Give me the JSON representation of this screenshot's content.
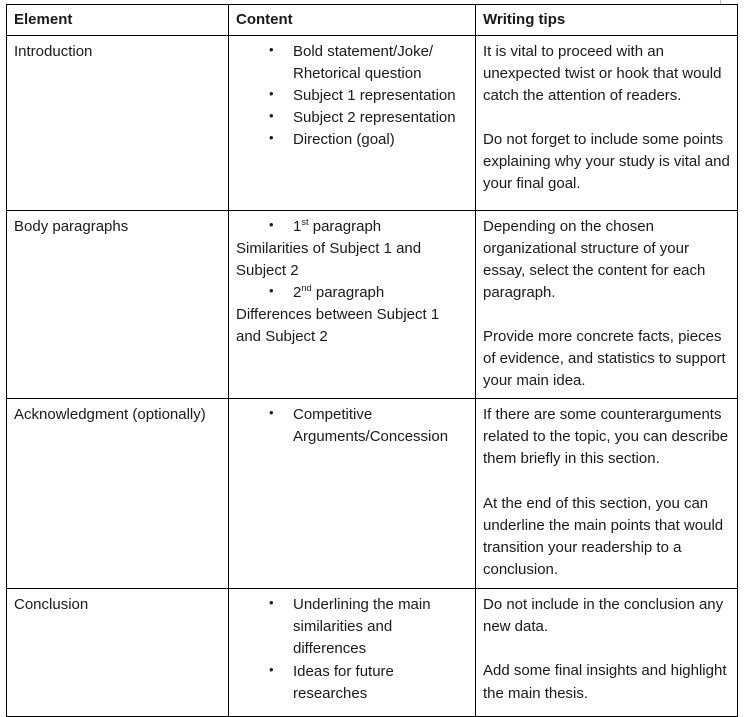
{
  "table": {
    "headers": {
      "element": "Element",
      "content": "Content",
      "tips": "Writing tips"
    },
    "rows": [
      {
        "element": "Introduction",
        "content_bullets": [
          "Bold statement/Joke/ Rhetorical question",
          "Subject 1 representation",
          "Subject 2 representation",
          "Direction (goal)"
        ],
        "tips": [
          "It is vital to proceed with an unexpected twist or hook that would catch the attention of readers.",
          "Do not forget to include some points explaining why your study is vital and your final goal."
        ]
      },
      {
        "element": "Body paragraphs",
        "content_blocks": [
          {
            "bullet_prefix": "1",
            "bullet_sup": "st",
            "bullet_rest": " paragraph",
            "continuation": "Similarities of Subject 1 and Subject 2"
          },
          {
            "bullet_prefix": "2",
            "bullet_sup": "nd",
            "bullet_rest": " paragraph",
            "continuation": "Differences between Subject 1 and Subject 2"
          }
        ],
        "tips": [
          "Depending on the chosen organizational structure of your essay, select the content for each paragraph.",
          "Provide more concrete facts, pieces of evidence, and statistics to support your main idea."
        ]
      },
      {
        "element": "Acknowledgment (optionally)",
        "content_bullets": [
          "Competitive Arguments/Concession"
        ],
        "tips": [
          "If there are some counterarguments related to the topic, you can describe them briefly in this section.",
          "At the end of this section, you can underline the main points that would transition your readership to a conclusion."
        ]
      },
      {
        "element": "Conclusion",
        "content_bullets": [
          "Underlining the main similarities and differences",
          "Ideas for future researches"
        ],
        "tips": [
          "Do not include in the conclusion any new data.",
          "Add some final insights and highlight the main thesis."
        ]
      }
    ]
  },
  "colors": {
    "border": "#000000",
    "text": "#1a1a1a",
    "margin_guide": "#b8b8b8",
    "background": "#ffffff"
  }
}
